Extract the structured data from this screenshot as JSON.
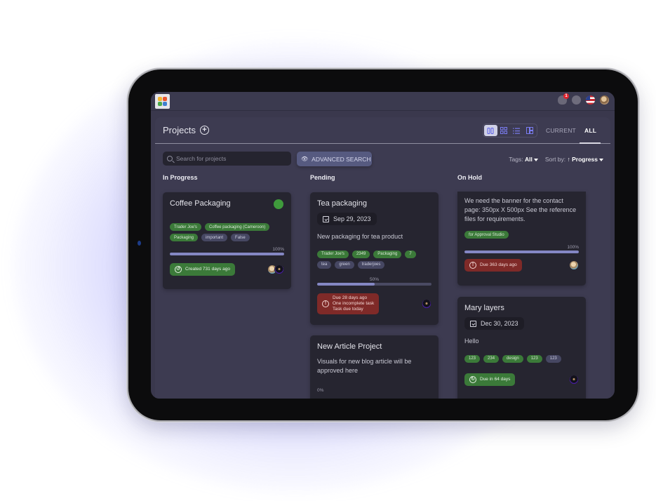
{
  "topbar": {
    "logo": "app-logo",
    "icons": [
      "bell-icon",
      "database-icon",
      "us-flag-icon",
      "user-avatar"
    ],
    "notification_count": "1"
  },
  "header": {
    "title": "Projects",
    "add_icon": "+",
    "views": [
      "kanban-view",
      "grid-view",
      "list-view",
      "gantt-view"
    ],
    "active_view": "kanban-view",
    "tabs": [
      {
        "label": "CURRENT",
        "active": false
      },
      {
        "label": "ALL",
        "active": true
      }
    ]
  },
  "toolbar": {
    "search_placeholder": "Search for projects",
    "search_value": "",
    "advanced_search_label": "ADVANCED SEARCH",
    "tags_label": "Tags:",
    "tags_value": "All",
    "sort_label": "Sort by:",
    "sort_arrow": "↑",
    "sort_value": "Progress"
  },
  "colors": {
    "accent": "#5a5ee8",
    "tag_green": "#3b7a39",
    "tag_gray": "#464762",
    "alert_red": "#7f2a28",
    "progress": "#8487c4"
  },
  "columns": [
    {
      "title": "In Progress",
      "cards": [
        {
          "title": "Coffee Packaging",
          "status_dot": "green",
          "tags": [
            {
              "label": "Trader Joe's",
              "color": "green"
            },
            {
              "label": "Coffee packaging (Cameroon)",
              "color": "green"
            },
            {
              "label": "Packaging",
              "color": "green"
            },
            {
              "label": "important",
              "color": "gray"
            },
            {
              "label": "False",
              "color": "gray"
            }
          ],
          "progress_label": "100%",
          "progress": 100,
          "badge": {
            "type": "green",
            "icon": "history-icon",
            "lines": [
              "Created 731 days ago"
            ]
          },
          "avatars": [
            "light",
            "dark"
          ]
        }
      ]
    },
    {
      "title": "Pending",
      "cards": [
        {
          "title": "Tea packaging",
          "date": "Sep 29, 2023",
          "description": "New packaging for tea product",
          "tags": [
            {
              "label": "Trader Joe's",
              "color": "green"
            },
            {
              "label": "2349",
              "color": "green"
            },
            {
              "label": "Packaging",
              "color": "green"
            },
            {
              "label": "7",
              "color": "green"
            },
            {
              "label": "tea",
              "color": "gray"
            },
            {
              "label": "green",
              "color": "gray"
            },
            {
              "label": "traderjoes",
              "color": "gray"
            }
          ],
          "progress_label": "50%",
          "progress": 50,
          "badge": {
            "type": "red",
            "icon": "alert-icon",
            "lines": [
              "Due 28 days ago",
              "One incomplete task",
              "Task due today"
            ]
          },
          "avatars": [
            "dark"
          ]
        },
        {
          "title": "New Article Project",
          "description": "Visuals for new blog article will be approved here",
          "progress_label": "0%"
        }
      ]
    },
    {
      "title": "On Hold",
      "cards": [
        {
          "description": "We need the banner for the contact page: 350px X 500px See the reference files for requirements.",
          "tags": [
            {
              "label": "for Approval Studio",
              "color": "green"
            }
          ],
          "progress_label": "100%",
          "progress": 100,
          "badge": {
            "type": "red",
            "icon": "alert-icon",
            "lines": [
              "Due 363 days ago"
            ]
          },
          "avatars": [
            "light"
          ]
        },
        {
          "title": "Mary layers",
          "date": "Dec 30, 2023",
          "description": "Hello",
          "tags": [
            {
              "label": "123",
              "color": "green"
            },
            {
              "label": "234",
              "color": "green"
            },
            {
              "label": "design",
              "color": "green"
            },
            {
              "label": "123",
              "color": "green"
            },
            {
              "label": "123",
              "color": "gray"
            }
          ],
          "badge": {
            "type": "green",
            "icon": "clock-forward-icon",
            "lines": [
              "Due in 64 days"
            ]
          },
          "avatars": [
            "dark"
          ]
        }
      ]
    }
  ]
}
